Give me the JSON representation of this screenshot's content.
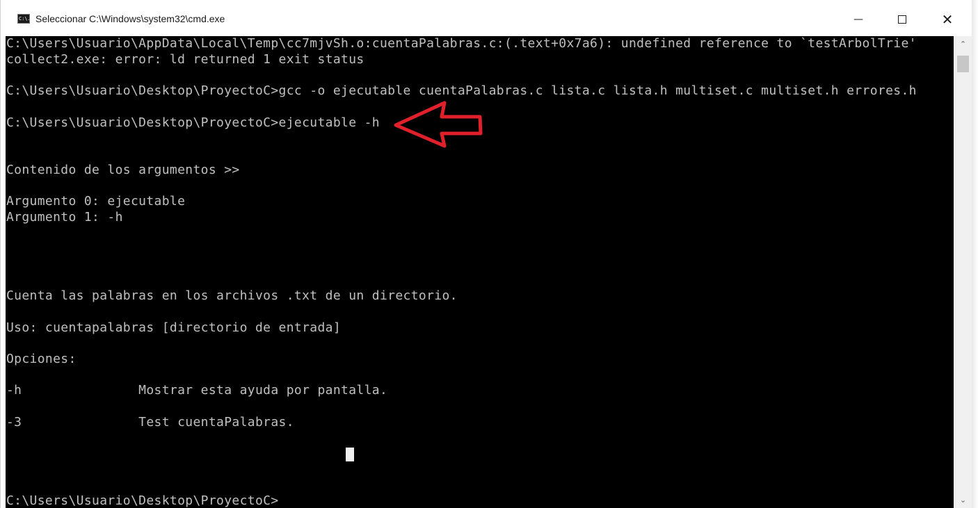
{
  "window": {
    "title": "Seleccionar C:\\Windows\\system32\\cmd.exe",
    "icon": "cmd-console-icon",
    "icon_text": "C:\\.",
    "minimize_glyph": "—",
    "close_glyph": "✕"
  },
  "console": {
    "lines": [
      "C:\\Users\\Usuario\\AppData\\Local\\Temp\\cc7mjvSh.o:cuentaPalabras.c:(.text+0x7a6): undefined reference to `testArbolTrie'",
      "collect2.exe: error: ld returned 1 exit status",
      "",
      "C:\\Users\\Usuario\\Desktop\\ProyectoC>gcc -o ejecutable cuentaPalabras.c lista.c lista.h multiset.c multiset.h errores.h",
      "",
      "C:\\Users\\Usuario\\Desktop\\ProyectoC>ejecutable -h",
      "",
      "",
      "Contenido de los argumentos >>",
      "",
      "Argumento 0: ejecutable",
      "Argumento 1: -h",
      "",
      "",
      "",
      "",
      "Cuenta las palabras en los archivos .txt de un directorio.",
      "",
      "Uso: cuentapalabras [directorio de entrada]",
      "",
      "Opciones:",
      "",
      "-h               Mostrar esta ayuda por pantalla.",
      "",
      "-3               Test cuentaPalabras.",
      "",
      "",
      "",
      "",
      "C:\\Users\\Usuario\\Desktop\\ProyectoC>"
    ]
  },
  "annotation": {
    "arrow_color": "#e0202a"
  },
  "scrollbar": {
    "up_glyph": "⌃",
    "down_glyph": "⌄"
  }
}
